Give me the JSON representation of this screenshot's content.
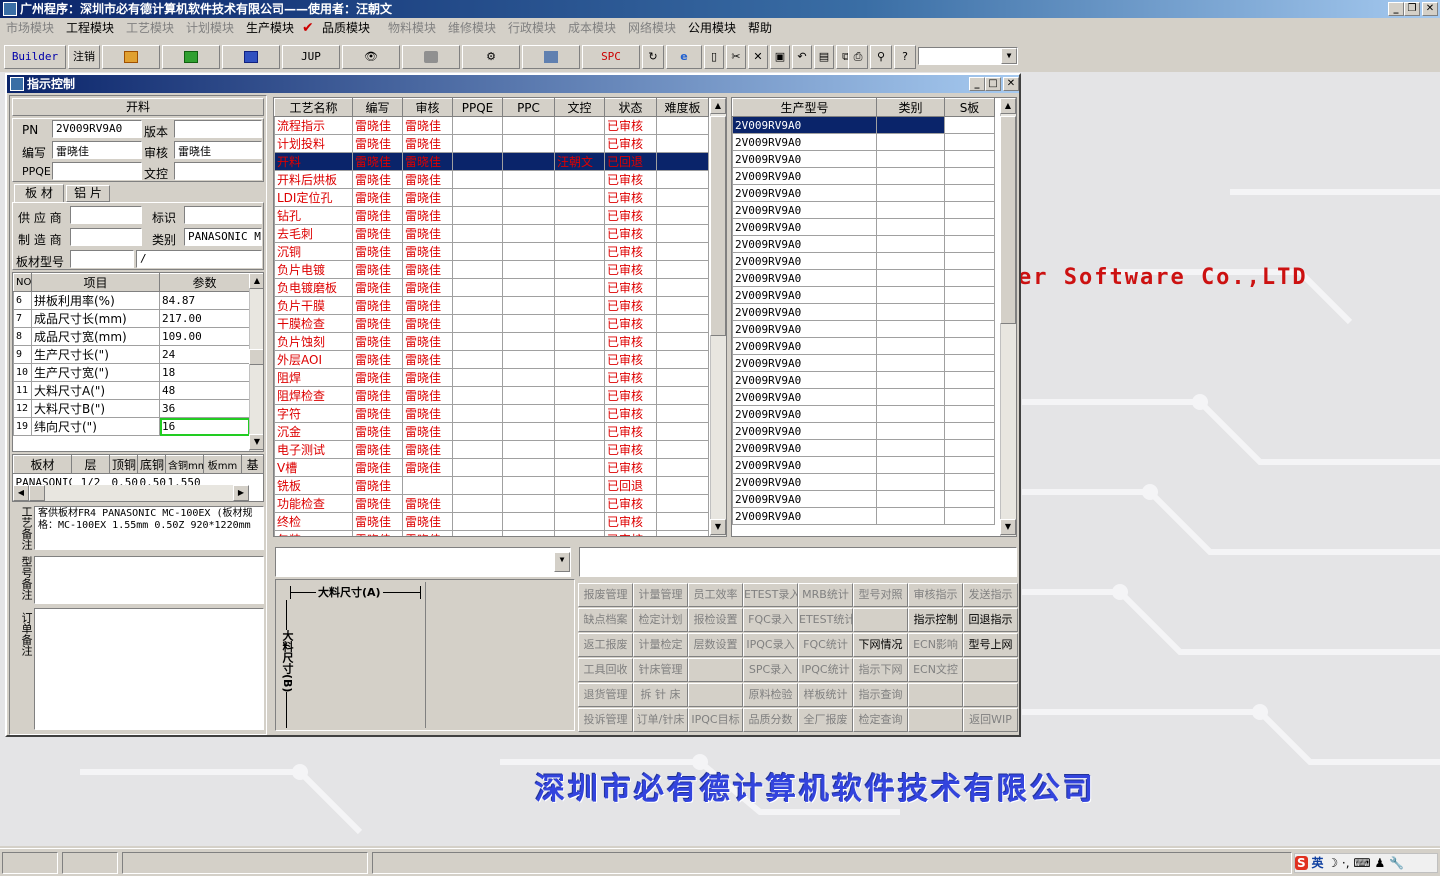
{
  "app_title": "广州程序：深圳市必有德计算机软件技术有限公司——使用者：汪朝文",
  "menu": [
    {
      "label": "市场模块",
      "enabled": false
    },
    {
      "label": "工程模块",
      "enabled": true
    },
    {
      "label": "工艺模块",
      "enabled": false
    },
    {
      "label": "计划模块",
      "enabled": false
    },
    {
      "label": "生产模块",
      "enabled": true
    },
    {
      "label": "品质模块",
      "enabled": true
    },
    {
      "label": "物料模块",
      "enabled": false
    },
    {
      "label": "维修模块",
      "enabled": false
    },
    {
      "label": "行政模块",
      "enabled": false
    },
    {
      "label": "成本模块",
      "enabled": false
    },
    {
      "label": "网络模块",
      "enabled": false
    },
    {
      "label": "公用模块",
      "enabled": true
    },
    {
      "label": "帮助",
      "enabled": true
    }
  ],
  "toolbar": {
    "builder": "Builder",
    "logout": "注销",
    "jup": "JUP",
    "spc": "SPC"
  },
  "window": {
    "title": "指示控制"
  },
  "left": {
    "header": "开料",
    "pn_label": "PN",
    "pn_value": "2V009RV9A0",
    "version_label": "版本",
    "version_value": "",
    "author_label": "编写",
    "author_value": "雷晓佳",
    "review_label": "审核",
    "review_value": "雷晓佳",
    "ppqe_label": "PPQE",
    "ppqe_value": "",
    "doc_label": "文控",
    "doc_value": "",
    "tab_board": "板 材",
    "tab_alu": "铝 片",
    "supplier_label": "供 应 商",
    "supplier_value": "",
    "mark_label": "标识",
    "mark_value": "",
    "maker_label": "制 造 商",
    "maker_value": "",
    "category_label": "类别",
    "category_value": "PANASONIC M",
    "model_label": "板材型号",
    "model_value": "",
    "model_value2": "/",
    "params_headers": [
      "NO",
      "项目",
      "参数"
    ],
    "params": [
      {
        "no": "6",
        "item": "拼板利用率(%)",
        "value": "84.87"
      },
      {
        "no": "7",
        "item": "成品尺寸长(mm)",
        "value": "217.00"
      },
      {
        "no": "8",
        "item": "成品尺寸宽(mm)",
        "value": "109.00"
      },
      {
        "no": "9",
        "item": "生产尺寸长(\")",
        "value": "24"
      },
      {
        "no": "10",
        "item": "生产尺寸宽(\")",
        "value": "18"
      },
      {
        "no": "11",
        "item": "大料尺寸A(\")",
        "value": "48"
      },
      {
        "no": "12",
        "item": "大料尺寸B(\")",
        "value": "36"
      },
      {
        "no": "19",
        "item": "纬向尺寸(\")",
        "value": "16"
      }
    ],
    "mat_headers": [
      "板材",
      "层",
      "顶铜",
      "底铜",
      "含铜mm",
      "板mm",
      "基"
    ],
    "mat_row": [
      "PANASONIC",
      "1/2",
      "0.50",
      "0.50",
      "1.550",
      "",
      ""
    ],
    "craft_note_label": "工艺备注",
    "craft_note": "客供板材FR4 PANASONIC MC-100EX (板材规格：MC-100EX 1.55mm 0.50Z 920*1220mm",
    "type_note_label": "型号备注",
    "order_note_label": "订单备注"
  },
  "process": {
    "headers": [
      "工艺名称",
      "编写",
      "审核",
      "PPQE",
      "PPC",
      "文控",
      "状态",
      "难度板"
    ],
    "rows": [
      [
        "流程指示",
        "雷晓佳",
        "雷晓佳",
        "",
        "",
        "",
        "已审核",
        ""
      ],
      [
        "计划投料",
        "雷晓佳",
        "雷晓佳",
        "",
        "",
        "",
        "已审核",
        ""
      ],
      [
        "开料",
        "雷晓佳",
        "雷晓佳",
        "",
        "",
        "汪朝文",
        "已回退",
        ""
      ],
      [
        "开料后烘板",
        "雷晓佳",
        "雷晓佳",
        "",
        "",
        "",
        "已审核",
        ""
      ],
      [
        "LDI定位孔",
        "雷晓佳",
        "雷晓佳",
        "",
        "",
        "",
        "已审核",
        ""
      ],
      [
        "钻孔",
        "雷晓佳",
        "雷晓佳",
        "",
        "",
        "",
        "已审核",
        ""
      ],
      [
        "去毛刺",
        "雷晓佳",
        "雷晓佳",
        "",
        "",
        "",
        "已审核",
        ""
      ],
      [
        "沉铜",
        "雷晓佳",
        "雷晓佳",
        "",
        "",
        "",
        "已审核",
        ""
      ],
      [
        "负片电镀",
        "雷晓佳",
        "雷晓佳",
        "",
        "",
        "",
        "已审核",
        ""
      ],
      [
        "负电镀磨板",
        "雷晓佳",
        "雷晓佳",
        "",
        "",
        "",
        "已审核",
        ""
      ],
      [
        "负片干膜",
        "雷晓佳",
        "雷晓佳",
        "",
        "",
        "",
        "已审核",
        ""
      ],
      [
        "干膜检查",
        "雷晓佳",
        "雷晓佳",
        "",
        "",
        "",
        "已审核",
        ""
      ],
      [
        "负片蚀刻",
        "雷晓佳",
        "雷晓佳",
        "",
        "",
        "",
        "已审核",
        ""
      ],
      [
        "外层AOI",
        "雷晓佳",
        "雷晓佳",
        "",
        "",
        "",
        "已审核",
        ""
      ],
      [
        "阻焊",
        "雷晓佳",
        "雷晓佳",
        "",
        "",
        "",
        "已审核",
        ""
      ],
      [
        "阻焊检查",
        "雷晓佳",
        "雷晓佳",
        "",
        "",
        "",
        "已审核",
        ""
      ],
      [
        "字符",
        "雷晓佳",
        "雷晓佳",
        "",
        "",
        "",
        "已审核",
        ""
      ],
      [
        "沉金",
        "雷晓佳",
        "雷晓佳",
        "",
        "",
        "",
        "已审核",
        ""
      ],
      [
        "电子测试",
        "雷晓佳",
        "雷晓佳",
        "",
        "",
        "",
        "已审核",
        ""
      ],
      [
        "V槽",
        "雷晓佳",
        "雷晓佳",
        "",
        "",
        "",
        "已审核",
        ""
      ],
      [
        "铣板",
        "雷晓佳",
        "",
        "",
        "",
        "",
        "已回退",
        ""
      ],
      [
        "功能检查",
        "雷晓佳",
        "雷晓佳",
        "",
        "",
        "",
        "已审核",
        ""
      ],
      [
        "终检",
        "雷晓佳",
        "雷晓佳",
        "",
        "",
        "",
        "已审核",
        ""
      ],
      [
        "包装",
        "雷晓佳",
        "雷晓佳",
        "",
        "",
        "",
        "已审核",
        ""
      ]
    ]
  },
  "models": {
    "headers": [
      "生产型号",
      "类别",
      "S板"
    ],
    "rows": [
      "2V009RV9A0",
      "2V009RV9A0",
      "2V009RV9A0",
      "2V009RV9A0",
      "2V009RV9A0",
      "2V009RV9A0",
      "2V009RV9A0",
      "2V009RV9A0",
      "2V009RV9A0",
      "2V009RV9A0",
      "2V009RV9A0",
      "2V009RV9A0",
      "2V009RV9A0",
      "2V009RV9A0",
      "2V009RV9A0",
      "2V009RV9A0",
      "2V009RV9A0",
      "2V009RV9A0",
      "2V009RV9A0",
      "2V009RV9A0",
      "2V009RV9A0",
      "2V009RV9A0",
      "2V009RV9A0",
      "2V009RV9A0"
    ]
  },
  "diagram": {
    "label_a": "大料尺寸(A)",
    "label_b": "大料尺寸(B)"
  },
  "buttons": [
    [
      {
        "l": "报废管理",
        "e": false
      },
      {
        "l": "计量管理",
        "e": false
      },
      {
        "l": "员工效率",
        "e": false
      },
      {
        "l": "ETEST录入",
        "e": false
      },
      {
        "l": "MRB统计",
        "e": false
      },
      {
        "l": "型号对照",
        "e": false
      },
      {
        "l": "审核指示",
        "e": false
      },
      {
        "l": "发送指示",
        "e": false
      }
    ],
    [
      {
        "l": "缺点档案",
        "e": false
      },
      {
        "l": "检定计划",
        "e": false
      },
      {
        "l": "报检设置",
        "e": false
      },
      {
        "l": "FQC录入",
        "e": false
      },
      {
        "l": "ETEST统计",
        "e": false
      },
      {
        "l": "",
        "e": false
      },
      {
        "l": "指示控制",
        "e": true
      },
      {
        "l": "回退指示",
        "e": true
      }
    ],
    [
      {
        "l": "返工报废",
        "e": false
      },
      {
        "l": "计量检定",
        "e": false
      },
      {
        "l": "层数设置",
        "e": false
      },
      {
        "l": "IPQC录入",
        "e": false
      },
      {
        "l": "FQC统计",
        "e": false
      },
      {
        "l": "下网情况",
        "e": true
      },
      {
        "l": "ECN影响",
        "e": false
      },
      {
        "l": "型号上网",
        "e": true
      }
    ],
    [
      {
        "l": "工具回收",
        "e": false
      },
      {
        "l": "针床管理",
        "e": false
      },
      {
        "l": "",
        "e": false
      },
      {
        "l": "SPC录入",
        "e": false
      },
      {
        "l": "IPQC统计",
        "e": false
      },
      {
        "l": "指示下网",
        "e": false
      },
      {
        "l": "ECN文控",
        "e": false
      },
      {
        "l": "",
        "e": false
      }
    ],
    [
      {
        "l": "退货管理",
        "e": false
      },
      {
        "l": "拆 针 床",
        "e": false
      },
      {
        "l": "",
        "e": false
      },
      {
        "l": "原料检验",
        "e": false
      },
      {
        "l": "样板统计",
        "e": false
      },
      {
        "l": "指示查询",
        "e": false
      },
      {
        "l": "",
        "e": false
      },
      {
        "l": "",
        "e": false
      }
    ],
    [
      {
        "l": "投诉管理",
        "e": false
      },
      {
        "l": "订单/针床",
        "e": false
      },
      {
        "l": "IPQC目标",
        "e": false
      },
      {
        "l": "品质分数",
        "e": false
      },
      {
        "l": "全厂报废",
        "e": false
      },
      {
        "l": "检定查询",
        "e": false
      },
      {
        "l": "",
        "e": false
      },
      {
        "l": "返回WIP",
        "e": false
      }
    ]
  ],
  "background": {
    "company_en": "er Software Co.,LTD",
    "company_cn": "深圳市必有德计算机软件技术有限公司"
  },
  "tray": {
    "ime": "英"
  },
  "colors": {
    "title": "#0a246a",
    "process_text": "#dd0000",
    "selection": "#0a246a",
    "focus_cell": "#22cc22"
  }
}
